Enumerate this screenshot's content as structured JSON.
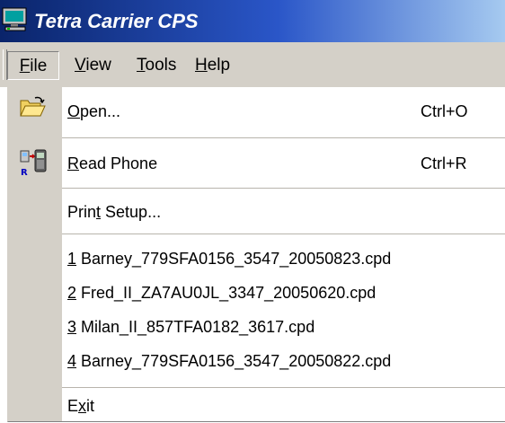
{
  "window": {
    "title": "Tetra Carrier CPS",
    "app_icon": "monitor-icon"
  },
  "menubar": {
    "items": [
      {
        "pre": "",
        "key": "F",
        "post": "ile"
      },
      {
        "pre": "",
        "key": "V",
        "post": "iew"
      },
      {
        "pre": "",
        "key": "T",
        "post": "ools"
      },
      {
        "pre": "",
        "key": "H",
        "post": "elp"
      }
    ]
  },
  "file_menu": {
    "open": {
      "pre": "",
      "key": "O",
      "post": "pen...",
      "shortcut": "Ctrl+O",
      "icon": "folder-open-icon"
    },
    "read_phone": {
      "pre": "",
      "key": "R",
      "post": "ead Phone",
      "shortcut": "Ctrl+R",
      "icon": "phone-read-icon"
    },
    "print_setup": {
      "pre": "Prin",
      "key": "t",
      "post": " Setup..."
    },
    "recent": [
      {
        "key": "1",
        "name": " Barney_779SFA0156_3547_20050823.cpd"
      },
      {
        "key": "2",
        "name": " Fred_II_ZA7AU0JL_3347_20050620.cpd"
      },
      {
        "key": "3",
        "name": " Milan_II_857TFA0182_3617.cpd"
      },
      {
        "key": "4",
        "name": " Barney_779SFA0156_3547_20050822.cpd"
      }
    ],
    "exit": {
      "pre": "E",
      "key": "x",
      "post": "it"
    }
  },
  "colors": {
    "title_gradient_start": "#0a246a",
    "title_gradient_end": "#a6caf0",
    "menu_face": "#d4d0c8",
    "dropdown_bg": "#ffffff"
  }
}
